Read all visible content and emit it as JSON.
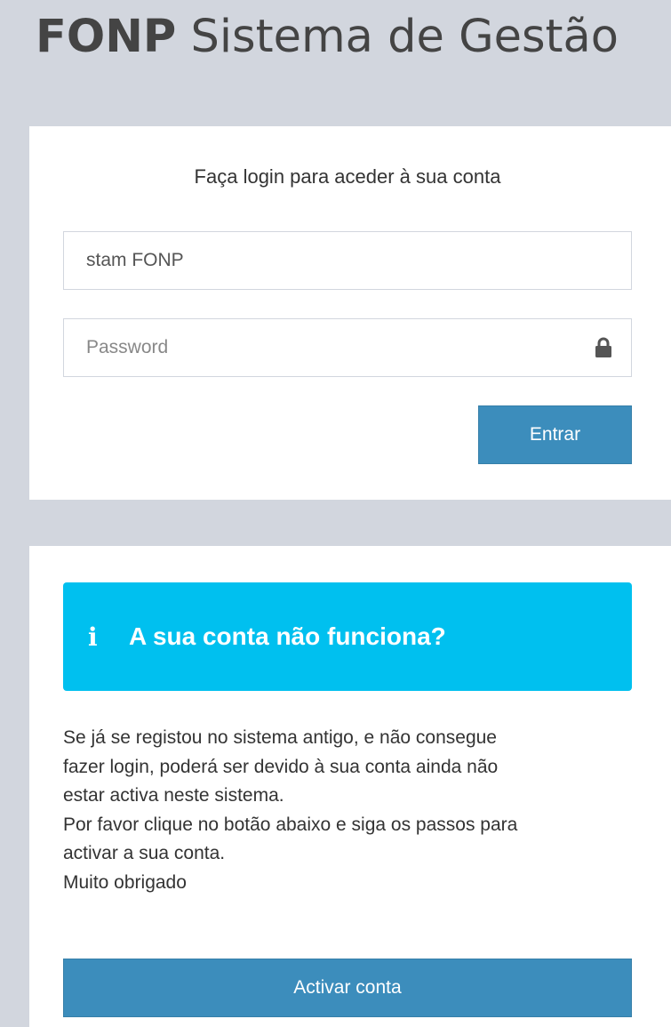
{
  "header": {
    "brand": "FONP",
    "title_rest": "Sistema de Gestão"
  },
  "login": {
    "message": "Faça login para aceder à sua conta",
    "username_value": "stam FONP",
    "password_placeholder": "Password",
    "password_icon": "lock-icon",
    "submit_label": "Entrar"
  },
  "help": {
    "callout_icon": "info-icon",
    "callout_icon_glyph": "i",
    "callout_title": "A sua conta não funciona?",
    "lines": [
      "Se já se registou no sistema antigo, e não consegue",
      "fazer login, poderá ser devido à sua conta ainda não",
      "estar activa neste sistema.",
      "Por favor clique no botão abaixo e siga os passos para",
      "activar a sua conta.",
      "Muito obrigado"
    ],
    "button_label": "Activar conta"
  },
  "colors": {
    "page_background": "#d2d6de",
    "primary_button": "#3c8dbc",
    "callout_info": "#00c0ef",
    "title_text": "#444444"
  }
}
